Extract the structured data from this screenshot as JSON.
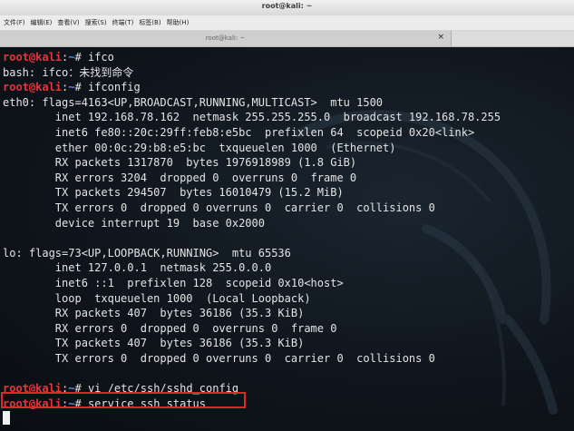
{
  "window": {
    "title": "root@kali: ~"
  },
  "menu": [
    "文件(F)",
    "编辑(E)",
    "查看(V)",
    "搜索(S)",
    "终端(T)",
    "标签(B)",
    "帮助(H)"
  ],
  "tab": {
    "label": "root@kali: ~",
    "close": "×"
  },
  "prompt": {
    "user": "root@kali",
    "sep": ":",
    "path": "~",
    "symbol": "# "
  },
  "lines": [
    {
      "type": "prompt",
      "cmd": "ifco"
    },
    {
      "type": "out",
      "text": "bash: ifco：未找到命令"
    },
    {
      "type": "prompt",
      "cmd": "ifconfig"
    },
    {
      "type": "out",
      "text": "eth0: flags=4163<UP,BROADCAST,RUNNING,MULTICAST>  mtu 1500"
    },
    {
      "type": "out",
      "text": "        inet 192.168.78.162  netmask 255.255.255.0  broadcast 192.168.78.255"
    },
    {
      "type": "out",
      "text": "        inet6 fe80::20c:29ff:feb8:e5bc  prefixlen 64  scopeid 0x20<link>"
    },
    {
      "type": "out",
      "text": "        ether 00:0c:29:b8:e5:bc  txqueuelen 1000  (Ethernet)"
    },
    {
      "type": "out",
      "text": "        RX packets 1317870  bytes 1976918989 (1.8 GiB)"
    },
    {
      "type": "out",
      "text": "        RX errors 3204  dropped 0  overruns 0  frame 0"
    },
    {
      "type": "out",
      "text": "        TX packets 294507  bytes 16010479 (15.2 MiB)"
    },
    {
      "type": "out",
      "text": "        TX errors 0  dropped 0 overruns 0  carrier 0  collisions 0"
    },
    {
      "type": "out",
      "text": "        device interrupt 19  base 0x2000"
    },
    {
      "type": "out",
      "text": ""
    },
    {
      "type": "out",
      "text": "lo: flags=73<UP,LOOPBACK,RUNNING>  mtu 65536"
    },
    {
      "type": "out",
      "text": "        inet 127.0.0.1  netmask 255.0.0.0"
    },
    {
      "type": "out",
      "text": "        inet6 ::1  prefixlen 128  scopeid 0x10<host>"
    },
    {
      "type": "out",
      "text": "        loop  txqueuelen 1000  (Local Loopback)"
    },
    {
      "type": "out",
      "text": "        RX packets 407  bytes 36186 (35.3 KiB)"
    },
    {
      "type": "out",
      "text": "        RX errors 0  dropped 0  overruns 0  frame 0"
    },
    {
      "type": "out",
      "text": "        TX packets 407  bytes 36186 (35.3 KiB)"
    },
    {
      "type": "out",
      "text": "        TX errors 0  dropped 0 overruns 0  carrier 0  collisions 0"
    },
    {
      "type": "out",
      "text": ""
    },
    {
      "type": "prompt",
      "cmd": "vi /etc/ssh/sshd_config"
    },
    {
      "type": "prompt",
      "cmd": "service ssh status"
    }
  ],
  "colors": {
    "prompt_user": "#e8343a",
    "prompt_path": "#4f8ff0",
    "highlight": "#e0262c",
    "background": "#0f151c"
  }
}
